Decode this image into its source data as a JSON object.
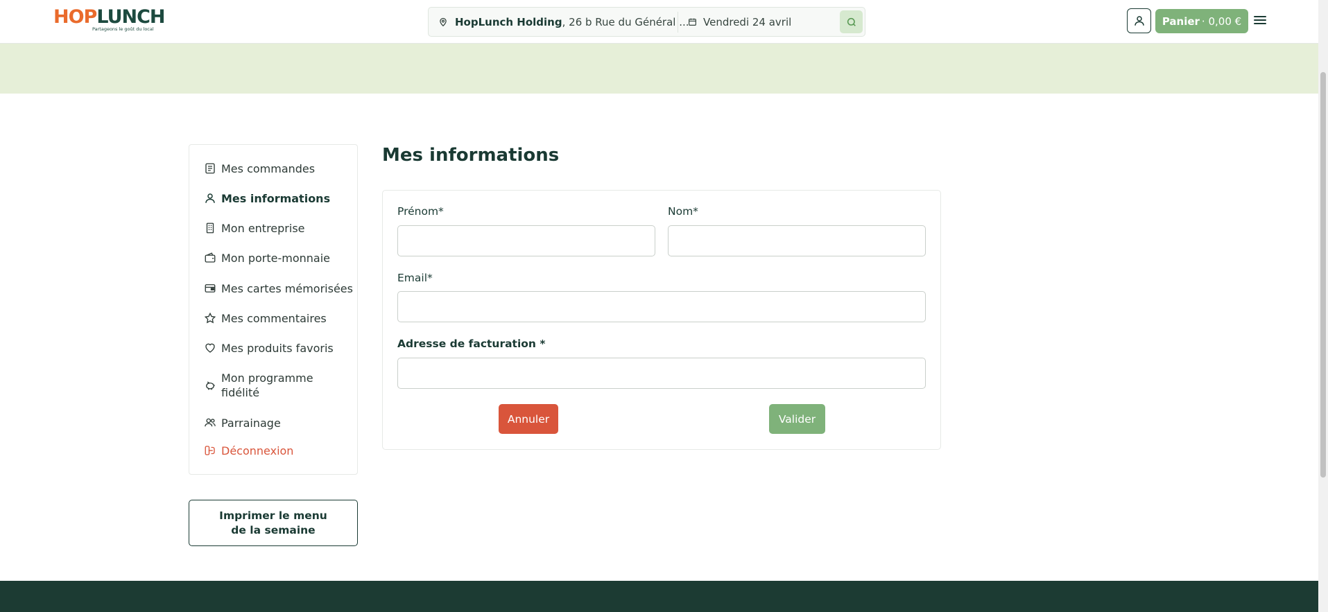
{
  "header": {
    "logo": {
      "part1": "HOP",
      "part2": "LUNCH",
      "tagline": "Partageons le goût du local"
    },
    "search": {
      "address_bold": "HopLunch Holding",
      "address_rest": ", 26 b Rue du Général ...",
      "date": "Vendredi 24 avril"
    },
    "cart": {
      "label": "Panier",
      "amount": "· 0,00 €"
    }
  },
  "sidebar": {
    "items": [
      {
        "label": "Mes commandes",
        "icon": "receipt-icon"
      },
      {
        "label": "Mes informations",
        "icon": "user-icon",
        "active": true
      },
      {
        "label": "Mon entreprise",
        "icon": "building-icon"
      },
      {
        "label": "Mon porte-monnaie",
        "icon": "wallet-icon"
      },
      {
        "label": "Mes cartes mémorisées",
        "icon": "credit-card-icon"
      },
      {
        "label": "Mes commentaires",
        "icon": "star-icon"
      },
      {
        "label": "Mes produits favoris",
        "icon": "heart-icon"
      },
      {
        "label": "Mon programme fidélité",
        "icon": "piggy-bank-icon"
      },
      {
        "label": "Parrainage",
        "icon": "users-icon"
      },
      {
        "label": "Déconnexion",
        "icon": "logout-icon"
      }
    ],
    "print_button": "Imprimer le menu de la semaine"
  },
  "main": {
    "title": "Mes informations",
    "form": {
      "firstname_label": "Prénom*",
      "lastname_label": "Nom*",
      "email_label": "Email*",
      "billing_label": "Adresse de facturation *",
      "firstname_value": "",
      "lastname_value": "",
      "email_value": "",
      "billing_value": "",
      "cancel_label": "Annuler",
      "submit_label": "Valider"
    }
  },
  "colors": {
    "brand_orange": "#ea6b2c",
    "brand_green_dark": "#1c3b33",
    "accent_green": "#7fb27a",
    "danger": "#d9553b",
    "banner": "#e6efd8"
  }
}
